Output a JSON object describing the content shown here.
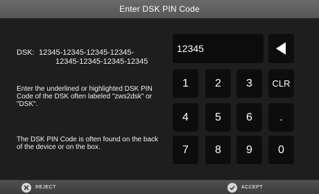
{
  "title": "Enter DSK PIN Code",
  "dsk": {
    "label": "DSK:",
    "line1": "12345-12345-12345-12345-",
    "line2": "12345-12345-12345-12345"
  },
  "help": {
    "instruction": "Enter the underlined or highlighted DSK PIN Code of the DSK often labeled \"zws2dsk\" or \"DSK\".",
    "location": "The DSK PIN Code is often found on the back of the device or on the box."
  },
  "pin": {
    "value": "12345"
  },
  "keypad": {
    "backspace_icon": "backspace-triangle-icon",
    "keys": [
      "1",
      "2",
      "3",
      "CLR",
      "4",
      "5",
      "6",
      ".",
      "7",
      "8",
      "9",
      "0"
    ]
  },
  "footer": {
    "reject_label": "REJECT",
    "reject_icon": "close-icon",
    "accept_label": "ACCEPT",
    "accept_icon": "check-icon"
  }
}
